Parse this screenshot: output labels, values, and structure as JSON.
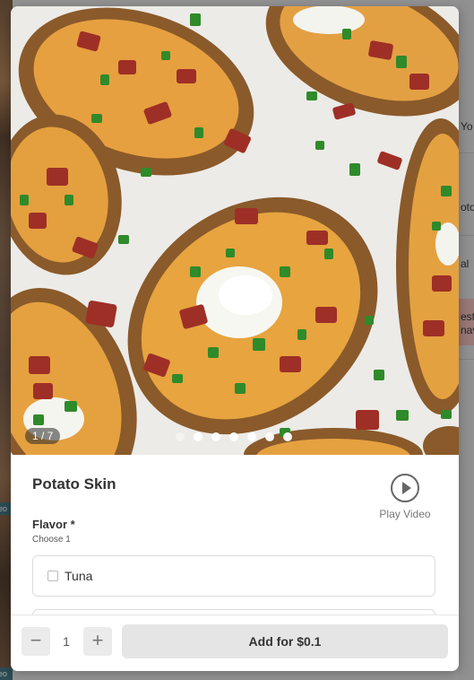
{
  "background": {
    "left_tags": [
      "eo",
      "eo"
    ],
    "right_fragments": [
      "Yo",
      "oto",
      "al",
      "est",
      "nav"
    ]
  },
  "product": {
    "image_counter": "1 / 7",
    "image_count": 7,
    "active_image_index": 0,
    "name": "Potato Skin",
    "play_video_label": "Play Video",
    "play_icon": "play-circle-icon"
  },
  "options": {
    "group_title": "Flavor *",
    "group_subtitle": "Choose 1",
    "items": [
      {
        "label": "Tuna",
        "checked": false
      },
      {
        "label": "",
        "checked": false
      }
    ]
  },
  "footer": {
    "minus_symbol": "−",
    "quantity": "1",
    "plus_symbol": "+",
    "add_label": "Add for $0.1"
  },
  "colors": {
    "overlay": "#000000",
    "button_bg": "#e5e5e5",
    "text": "#333333"
  }
}
